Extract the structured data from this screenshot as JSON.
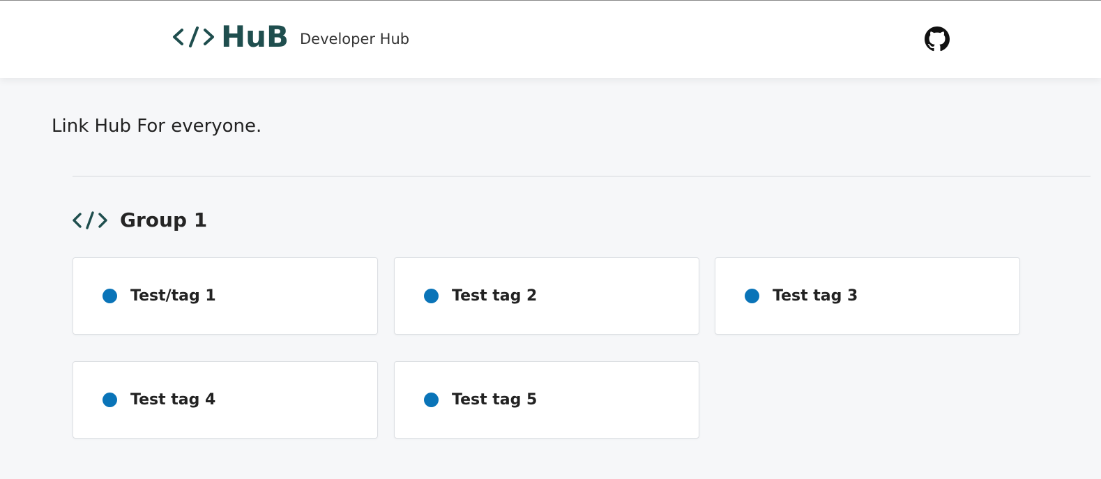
{
  "header": {
    "logo_text": "HuB",
    "logo_icon": "code-brackets-icon",
    "tagline": "Developer Hub",
    "github_icon": "github-icon"
  },
  "hero": {
    "text": "Link Hub For everyone."
  },
  "group": {
    "icon": "code-brackets-icon",
    "title": "Group 1",
    "cards": [
      {
        "label": "Test/tag 1",
        "dot_color": "#0a74b8"
      },
      {
        "label": "Test tag 2",
        "dot_color": "#0a74b8"
      },
      {
        "label": "Test tag 3",
        "dot_color": "#0a74b8"
      },
      {
        "label": "Test tag 4",
        "dot_color": "#0a74b8"
      },
      {
        "label": "Test tag 5",
        "dot_color": "#0a74b8"
      }
    ]
  },
  "colors": {
    "brand": "#1f4e4e",
    "background": "#f6f7f9",
    "card": "#ffffff",
    "accent_dot": "#0a74b8"
  }
}
